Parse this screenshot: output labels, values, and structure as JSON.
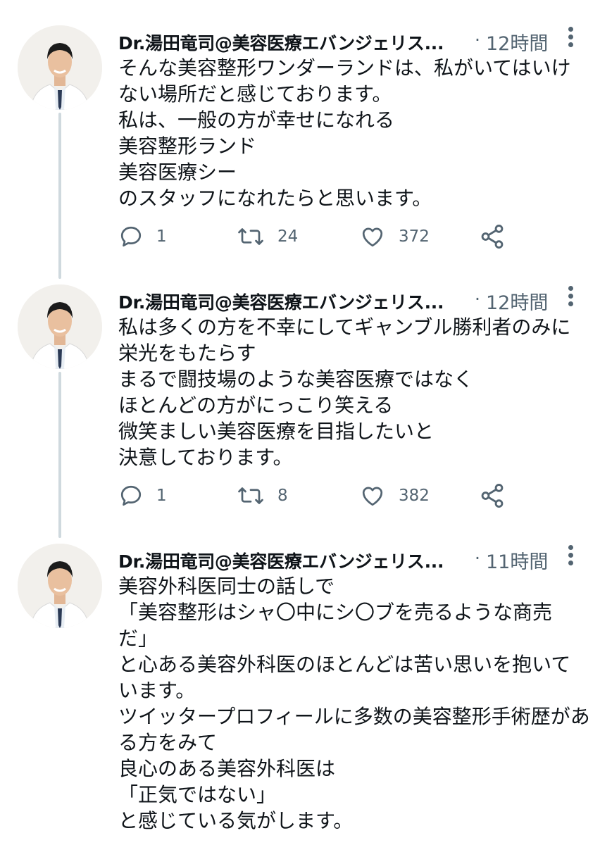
{
  "tweets": [
    {
      "author": "Dr.湯田竜司@美容医療エバンジェリス...",
      "separator": "·",
      "time": "12時間",
      "lines": [
        "そんな美容整形ワンダーランドは、私がいてはいけ",
        "ない場所だと感じております。",
        "私は、一般の方が幸せになれる",
        "美容整形ランド",
        "美容医療シー",
        "のスタッフになれたらと思います。"
      ],
      "replies": "1",
      "retweets": "24",
      "likes": "372"
    },
    {
      "author": "Dr.湯田竜司@美容医療エバンジェリス...",
      "separator": "·",
      "time": "12時間",
      "lines": [
        "私は多くの方を不幸にしてギャンブル勝利者のみに",
        "栄光をもたらす",
        "まるで闘技場のような美容医療ではなく",
        "ほとんどの方がにっこり笑える",
        "微笑ましい美容医療を目指したいと",
        "決意しております。"
      ],
      "replies": "1",
      "retweets": "8",
      "likes": "382"
    },
    {
      "author": "Dr.湯田竜司@美容医療エバンジェリス...",
      "separator": "·",
      "time": "11時間",
      "lines": [
        "美容外科医同士の話しで",
        "「美容整形はシャ〇中にシ〇ブを売るような商売",
        "だ」",
        "と心ある美容外科医のほとんどは苦い思いを抱いて",
        "います。",
        "ツイッタープロフィールに多数の美容整形手術歴があ",
        "る方をみて",
        "良心のある美容外科医は",
        "「正気ではない」",
        "と感じている気がします。"
      ]
    }
  ],
  "icons": {
    "reply": "reply-icon",
    "retweet": "retweet-icon",
    "like": "heart-icon",
    "share": "share-icon",
    "more": "more-icon"
  },
  "colors": {
    "text": "#0f1419",
    "secondary": "#536471",
    "thread_line": "#cfd9de"
  }
}
